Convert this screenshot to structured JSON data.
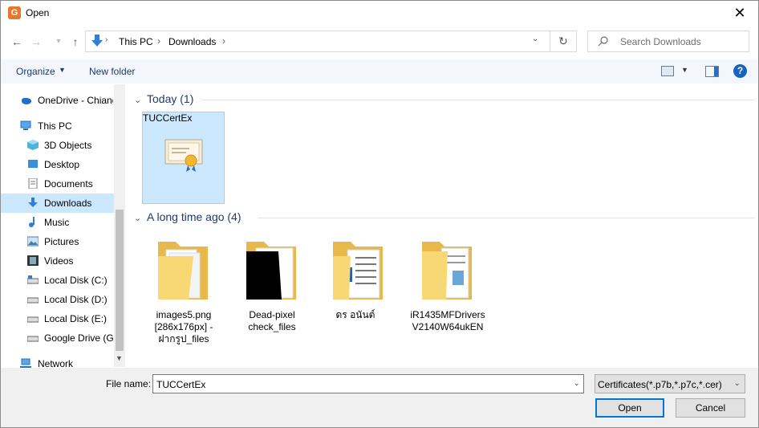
{
  "window": {
    "title": "Open",
    "app_icon": "app-icon",
    "close_icon": "close-icon"
  },
  "address": {
    "crumbs": [
      "This PC",
      "Downloads"
    ],
    "icon": "download-arrow-icon"
  },
  "search": {
    "placeholder": "Search Downloads"
  },
  "toolbar": {
    "organize": "Organize",
    "new_folder": "New folder"
  },
  "nav_pane": {
    "items": [
      {
        "label": "OneDrive - Chiang",
        "icon": "cloud-icon"
      },
      {
        "label": "This PC",
        "icon": "computer-icon"
      },
      {
        "label": "3D Objects",
        "icon": "cube-icon"
      },
      {
        "label": "Desktop",
        "icon": "desktop-icon"
      },
      {
        "label": "Documents",
        "icon": "document-icon"
      },
      {
        "label": "Downloads",
        "icon": "download-icon",
        "selected": true
      },
      {
        "label": "Music",
        "icon": "music-icon"
      },
      {
        "label": "Pictures",
        "icon": "picture-icon"
      },
      {
        "label": "Videos",
        "icon": "video-icon"
      },
      {
        "label": "Local Disk (C:)",
        "icon": "drive-icon"
      },
      {
        "label": "Local Disk (D:)",
        "icon": "drive-icon"
      },
      {
        "label": "Local Disk (E:)",
        "icon": "drive-icon"
      },
      {
        "label": "Google Drive (G:",
        "icon": "drive-icon"
      },
      {
        "label": "Network",
        "icon": "network-icon"
      }
    ]
  },
  "groups": [
    {
      "header": "Today (1)",
      "items": [
        {
          "name": "TUCCertEx",
          "icon": "certificate-icon",
          "selected": true
        }
      ]
    },
    {
      "header": "A long time ago (4)",
      "items": [
        {
          "name_lines": [
            "images5.png",
            "[286x176px] -",
            "ฝากรูป_files"
          ],
          "icon": "folder-icon"
        },
        {
          "name_lines": [
            "Dead-pixel",
            "check_files"
          ],
          "icon": "folder-icon"
        },
        {
          "name_lines": [
            "ดร อนันต์"
          ],
          "icon": "folder-icon"
        },
        {
          "name_lines": [
            "iR1435MFDrivers",
            "V2140W64ukEN"
          ],
          "icon": "folder-icon"
        }
      ]
    }
  ],
  "footer": {
    "file_name_label": "File name:",
    "file_name_value": "TUCCertEx",
    "filter_value": "Certificates(*.p7b,*.p7c,*.cer)",
    "open": "Open",
    "cancel": "Cancel"
  },
  "colors": {
    "accent": "#0078d7",
    "selection": "#cce8ff",
    "header_text": "#1e3a6e",
    "folder": "#f8d775"
  }
}
